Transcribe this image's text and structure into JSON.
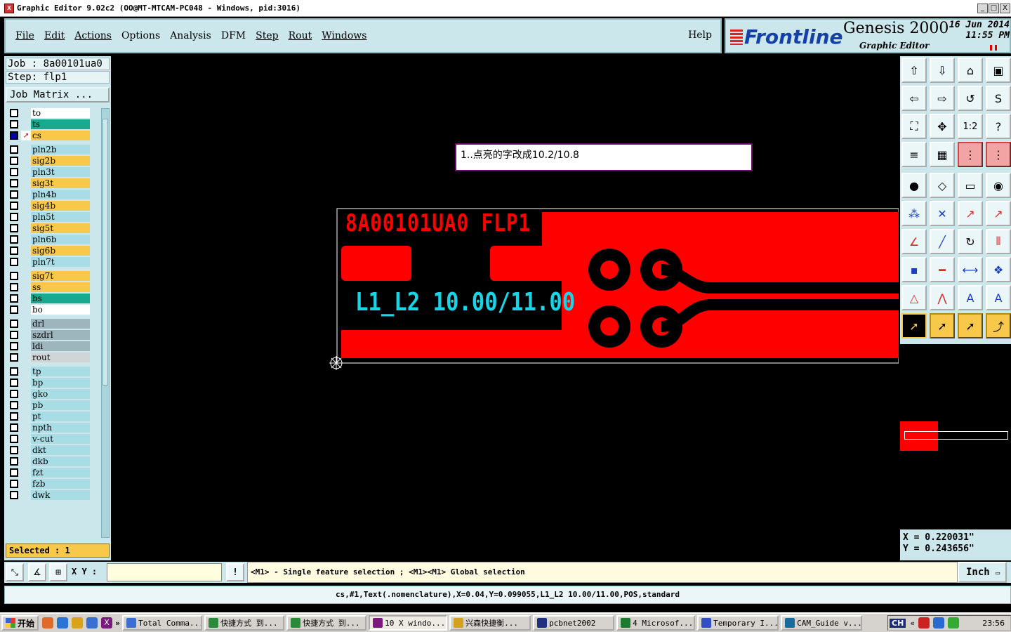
{
  "window": {
    "title": "Graphic Editor 9.02c2  (OO@MT-MTCAM-PC048 - Windows, pid:3016)",
    "icon": "x",
    "min_label": "_",
    "max_label": "□",
    "close_label": "X"
  },
  "menu": {
    "items": [
      "File",
      "Edit",
      "Actions",
      "Options",
      "Analysis",
      "DFM",
      "Step",
      "Rout",
      "Windows"
    ],
    "help": "Help"
  },
  "brand": {
    "logo": "Frontline",
    "product": "Genesis 2000",
    "subtitle": "Graphic Editor",
    "date_line": "16 Jun 2014",
    "time_line": "11:55 PM"
  },
  "left": {
    "job": "Job : 8a00101ua0",
    "step": "Step: flp1",
    "job_matrix": "Job Matrix ...",
    "selected": "Selected : 1",
    "layers": [
      {
        "name": "to",
        "color": "#ffffff",
        "active": false
      },
      {
        "name": "ts",
        "color": "#1aa88f",
        "active": false
      },
      {
        "name": "cs",
        "color": "#f7c84a",
        "active": true,
        "work": true
      },
      {
        "name": "pln2b",
        "color": "#a8dde5",
        "active": false
      },
      {
        "name": "sig2b",
        "color": "#f7c84a",
        "active": false
      },
      {
        "name": "pln3t",
        "color": "#a8dde5",
        "active": false
      },
      {
        "name": "sig3t",
        "color": "#f7c84a",
        "active": false
      },
      {
        "name": "pln4b",
        "color": "#a8dde5",
        "active": false
      },
      {
        "name": "sig4b",
        "color": "#f7c84a",
        "active": false
      },
      {
        "name": "pln5t",
        "color": "#a8dde5",
        "active": false
      },
      {
        "name": "sig5t",
        "color": "#f7c84a",
        "active": false
      },
      {
        "name": "pln6b",
        "color": "#a8dde5",
        "active": false
      },
      {
        "name": "sig6b",
        "color": "#f7c84a",
        "active": false
      },
      {
        "name": "pln7t",
        "color": "#a8dde5",
        "active": false
      },
      {
        "name": "sig7t",
        "color": "#f7c84a",
        "active": false
      },
      {
        "name": "ss",
        "color": "#f7c84a",
        "active": false
      },
      {
        "name": "bs",
        "color": "#1aa88f",
        "active": false
      },
      {
        "name": "bo",
        "color": "#ffffff",
        "active": false
      },
      {
        "name": "drl",
        "color": "#9fb5bd",
        "active": false
      },
      {
        "name": "szdrl",
        "color": "#9fb5bd",
        "active": false
      },
      {
        "name": "ldi",
        "color": "#9fb5bd",
        "active": false
      },
      {
        "name": "rout",
        "color": "#d0d6d8",
        "active": false
      },
      {
        "name": "tp",
        "color": "#a8dde5",
        "active": false
      },
      {
        "name": "bp",
        "color": "#a8dde5",
        "active": false
      },
      {
        "name": "gko",
        "color": "#a8dde5",
        "active": false
      },
      {
        "name": "pb",
        "color": "#a8dde5",
        "active": false
      },
      {
        "name": "pt",
        "color": "#a8dde5",
        "active": false
      },
      {
        "name": "npth",
        "color": "#a8dde5",
        "active": false
      },
      {
        "name": "v-cut",
        "color": "#a8dde5",
        "active": false
      },
      {
        "name": "dkt",
        "color": "#a8dde5",
        "active": false
      },
      {
        "name": "dkb",
        "color": "#a8dde5",
        "active": false
      },
      {
        "name": "fzt",
        "color": "#a8dde5",
        "active": false
      },
      {
        "name": "fzb",
        "color": "#a8dde5",
        "active": false
      },
      {
        "name": "dwk",
        "color": "#a8dde5",
        "active": false
      }
    ]
  },
  "canvas": {
    "note": "1..点亮的字改成10.2/10.8",
    "board_text_1": "8A00101UA0 FLP1",
    "board_text_2": "L1_L2 10.00/11.00",
    "copper_color": "#ff0000",
    "text_color_1": "#ff0000",
    "text_color_2": "#19d4e6"
  },
  "coords": {
    "x": "X = 0.220031\"",
    "y": "Y = 0.243656\""
  },
  "command": {
    "xy_label": "X Y :",
    "xy_value": "",
    "exclaim": "!",
    "hint": "<M1> - Single feature selection ; <M1><M1> Global selection",
    "unit": "Inch"
  },
  "status": "cs,#1,Text(.nomenclature),X=0.04,Y=0.099055,L1_L2 10.00/11.00,POS,standard",
  "taskbar": {
    "start": "开始",
    "tasks": [
      {
        "label": "Total Comma...",
        "icon_color": "#3a6ed1"
      },
      {
        "label": "快捷方式 到...",
        "icon_color": "#2a8a3a"
      },
      {
        "label": "快捷方式 到...",
        "icon_color": "#2a8a3a"
      },
      {
        "label": "10 X windo...",
        "icon_color": "#7a1a7a",
        "active": true
      },
      {
        "label": "兴森快捷衡...",
        "icon_color": "#d4a020"
      },
      {
        "label": "pcbnet2002",
        "icon_color": "#203080"
      },
      {
        "label": "4 Microsof...",
        "icon_color": "#1e7a2e"
      },
      {
        "label": "Temporary I...",
        "icon_color": "#3050c0"
      },
      {
        "label": "CAM_Guide v...",
        "icon_color": "#1a6a9a"
      }
    ],
    "lang": "CH",
    "clock": "23:56"
  }
}
